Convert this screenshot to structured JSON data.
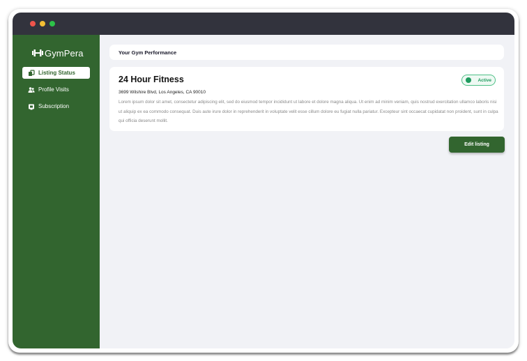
{
  "window": {
    "controls": [
      "close",
      "minimize",
      "maximize"
    ]
  },
  "sidebar": {
    "brand": "GymPera",
    "items": [
      {
        "label": "Listing Status",
        "icon": "listing-icon",
        "active": true
      },
      {
        "label": "Profile Visits",
        "icon": "users-icon",
        "active": false
      },
      {
        "label": "Subscription",
        "icon": "subscription-icon",
        "active": false
      }
    ]
  },
  "main": {
    "section_title": "Your Gym Performance",
    "listing": {
      "name": "24 Hour Fitness",
      "address": "3699 Wilshire Blvd, Los Angeles, CA 90010",
      "description": "Lorem ipsum dolor sit amet, consectetur adipiscing elit, sed do eiusmod tempor incididunt ut labore et dolore magna aliqua. Ut enim ad minim veniam, quis nostrud exercitation ullamco laboris nisi ut aliquip ex ea commodo consequat. Duis aute irure dolor in reprehenderit in voluptate velit esse cillum dolore eu fugiat nulla pariatur. Excepteur sint occaecat cupidatat non proident, sunt in culpa qui officia deserunt mollit.",
      "status": "Active"
    },
    "edit_label": "Edit listing"
  },
  "colors": {
    "sidebar": "#32652f",
    "titlebar": "#32333d",
    "status": "#1e9b5e"
  }
}
